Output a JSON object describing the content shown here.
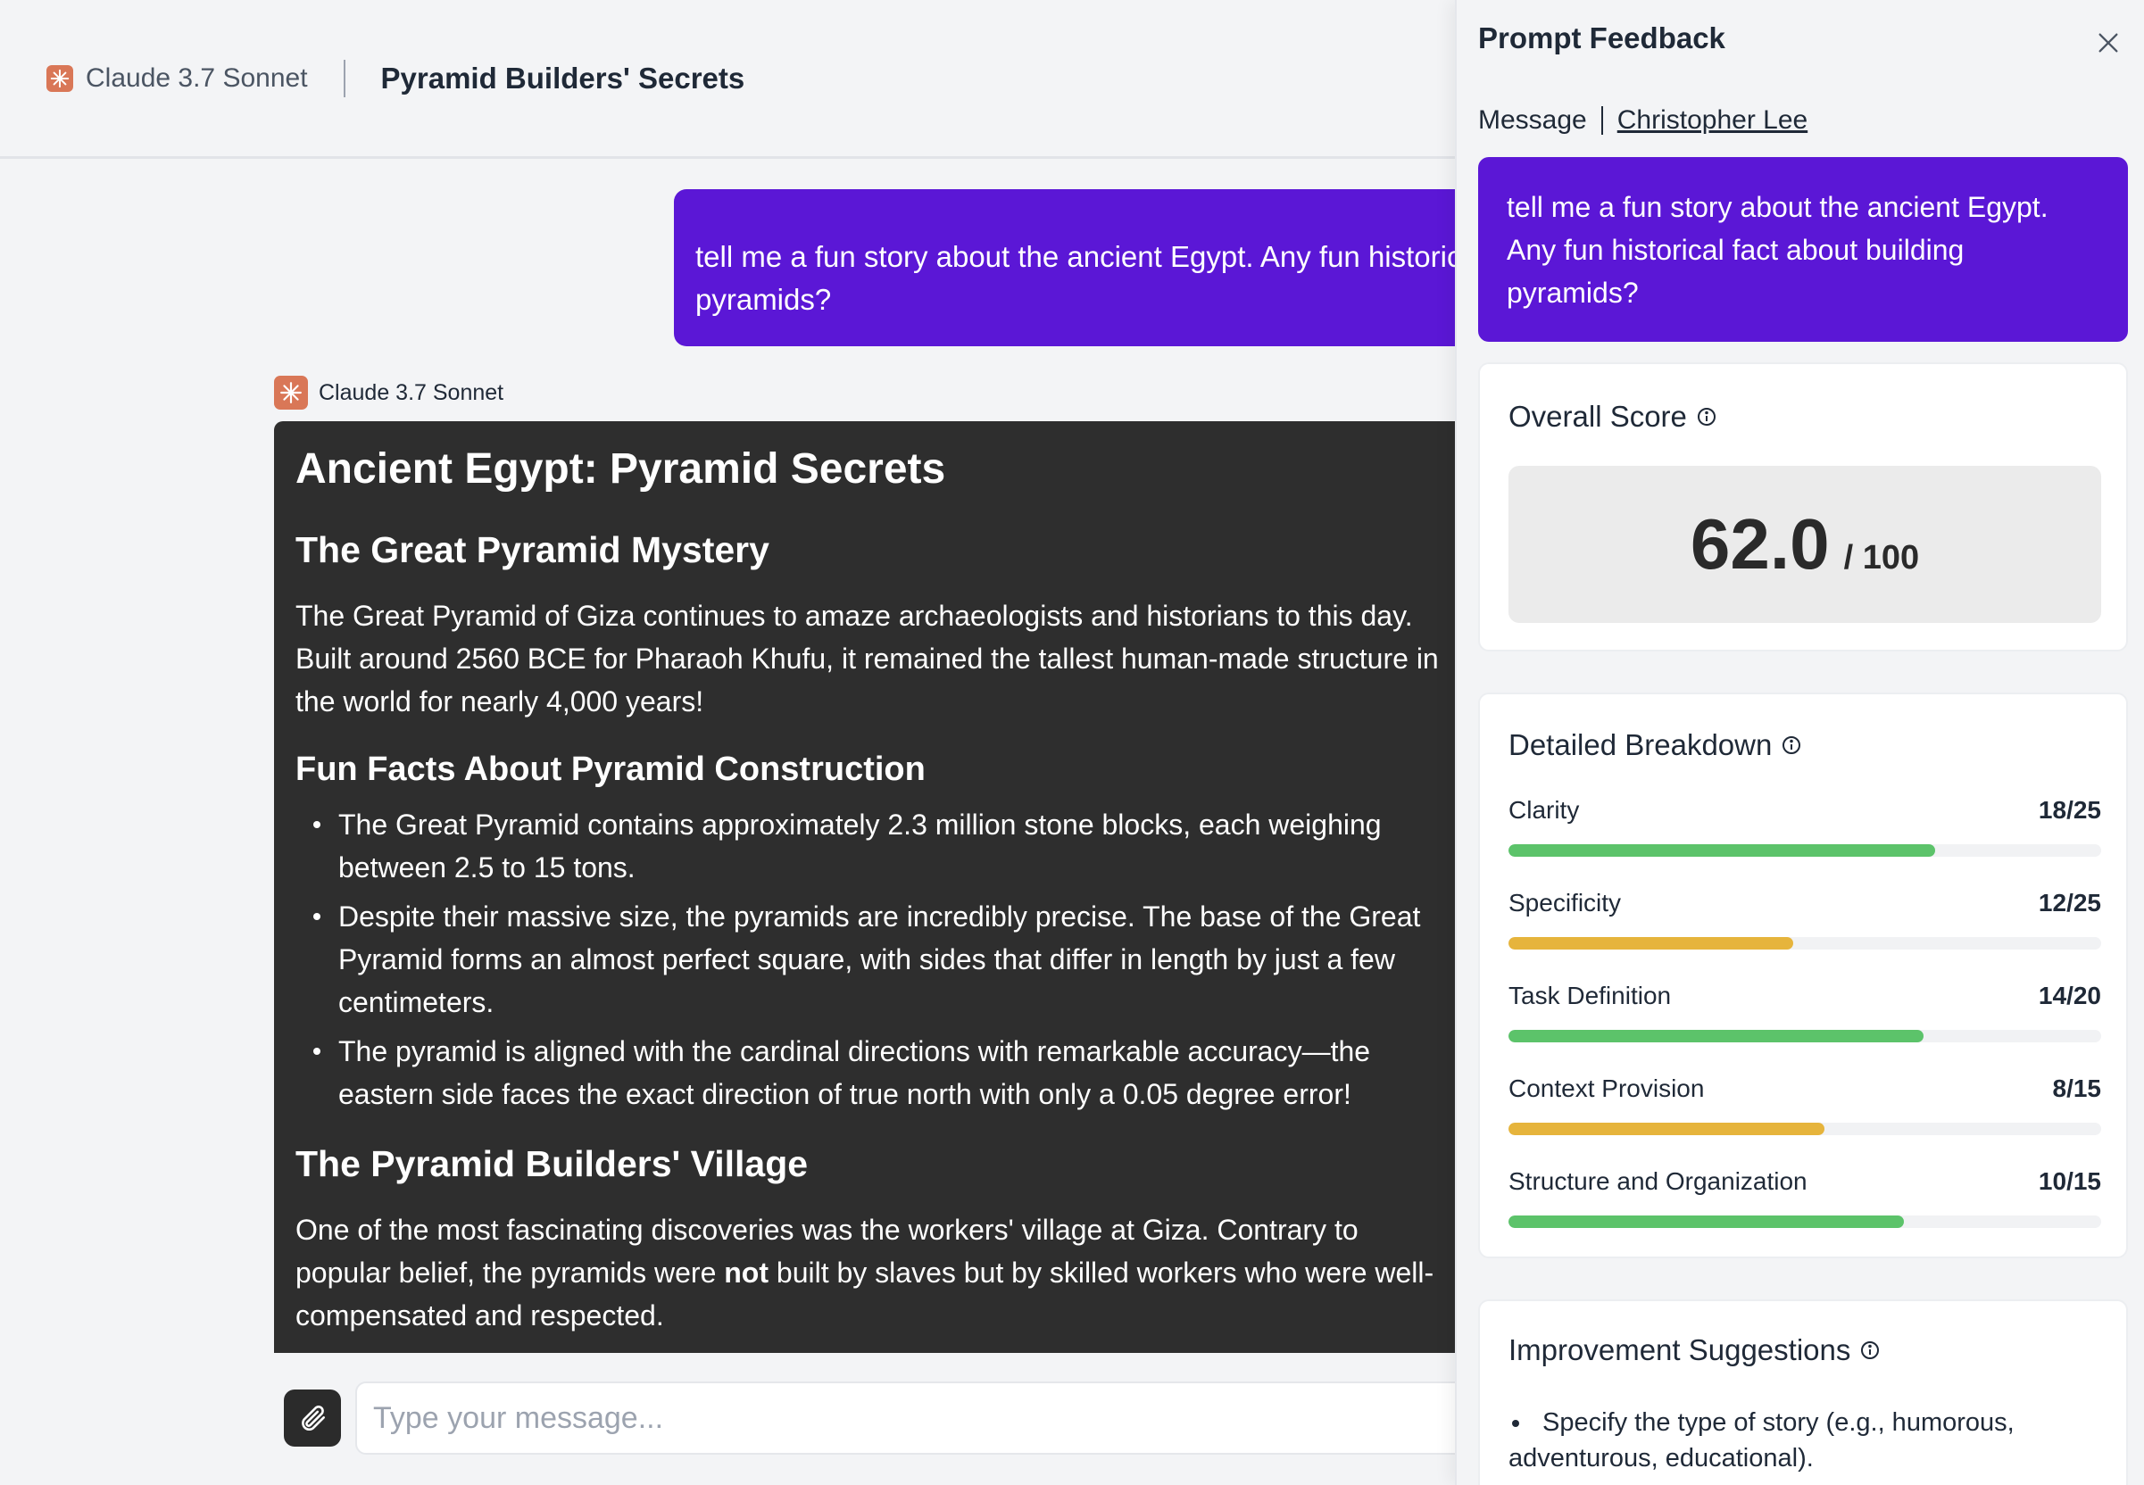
{
  "header": {
    "model_name": "Claude 3.7 Sonnet",
    "conversation_title": "Pyramid Builders' Secrets"
  },
  "chat": {
    "user_message_line1": "tell me a fun story about the ancient Egypt. Any fun historical fact about building",
    "user_message_line2": "pyramids?",
    "assistant_label": "Claude 3.7 Sonnet",
    "response": {
      "h1": "Ancient Egypt: Pyramid Secrets",
      "section1_title": "The Great Pyramid Mystery",
      "section1_text": "The Great Pyramid of Giza continues to amaze archaeologists and historians to this day. Built around 2560 BCE for Pharaoh Khufu, it remained the tallest human-made structure in the world for nearly 4,000 years!",
      "section2_title": "Fun Facts About Pyramid Construction",
      "facts": [
        "The Great Pyramid contains approximately 2.3 million stone blocks, each weighing between 2.5 to 15 tons.",
        "Despite their massive size, the pyramids are incredibly precise. The base of the Great Pyramid forms an almost perfect square, with sides that differ in length by just a few centimeters.",
        "The pyramid is aligned with the cardinal directions with remarkable accuracy—the eastern side faces the exact direction of true north with only a 0.05 degree error!"
      ],
      "section3_title": "The Pyramid Builders' Village",
      "section3_text_a": "One of the most fascinating discoveries was the workers' village at Giza. Contrary to popular belief, the pyramids were ",
      "section3_bold": "not",
      "section3_text_b": " built by slaves but by skilled workers who were well-compensated and respected."
    }
  },
  "composer": {
    "placeholder": "Type your message..."
  },
  "panel": {
    "title": "Prompt Feedback",
    "meta_label": "Message",
    "author": "Christopher Lee",
    "prompt_text": "tell me a fun story about the ancient Egypt. Any fun historical fact about building pyramids?",
    "overall_title": "Overall Score",
    "score": "62.0",
    "score_max": "/ 100",
    "breakdown_title": "Detailed Breakdown",
    "criteria": [
      {
        "label": "Clarity",
        "value": "18/25",
        "fraction": 0.72,
        "color": "#5cc36a"
      },
      {
        "label": "Specificity",
        "value": "12/25",
        "fraction": 0.48,
        "color": "#e6b43c"
      },
      {
        "label": "Task Definition",
        "value": "14/20",
        "fraction": 0.7,
        "color": "#5cc36a"
      },
      {
        "label": "Context Provision",
        "value": "8/15",
        "fraction": 0.533,
        "color": "#e6b43c"
      },
      {
        "label": "Structure and Organization",
        "value": "10/15",
        "fraction": 0.667,
        "color": "#5cc36a"
      }
    ],
    "suggestions_title": "Improvement Suggestions",
    "suggestions_first_a": "Specify the type of story (e.g., humorous,",
    "suggestions_first_b": "adventurous, educational)."
  },
  "colors": {
    "accent_purple": "#5b17d6",
    "claude_orange": "#d97757",
    "bar_green": "#5cc36a",
    "bar_yellow": "#e6b43c"
  }
}
